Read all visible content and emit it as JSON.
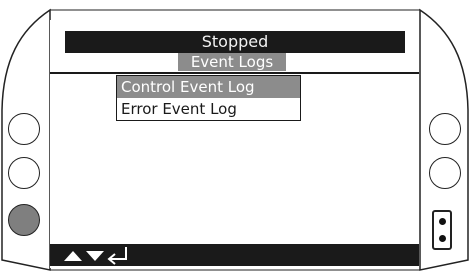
{
  "status": {
    "text": "Stopped"
  },
  "menu": {
    "title": "Event Logs",
    "items": [
      {
        "label": "Control Event Log",
        "selected": true
      },
      {
        "label": "Error Event Log",
        "selected": false
      }
    ]
  },
  "nav": {
    "icons": [
      "up-arrow-icon",
      "down-arrow-icon",
      "enter-icon"
    ]
  },
  "side_buttons": {
    "left": [
      "circle-button",
      "circle-button",
      "filled-circle-button"
    ],
    "right": [
      "circle-button",
      "circle-button"
    ]
  },
  "colors": {
    "bar": "#1a1a1a",
    "highlight": "#8c8c8c",
    "button_fill": "#7f7f7f"
  }
}
